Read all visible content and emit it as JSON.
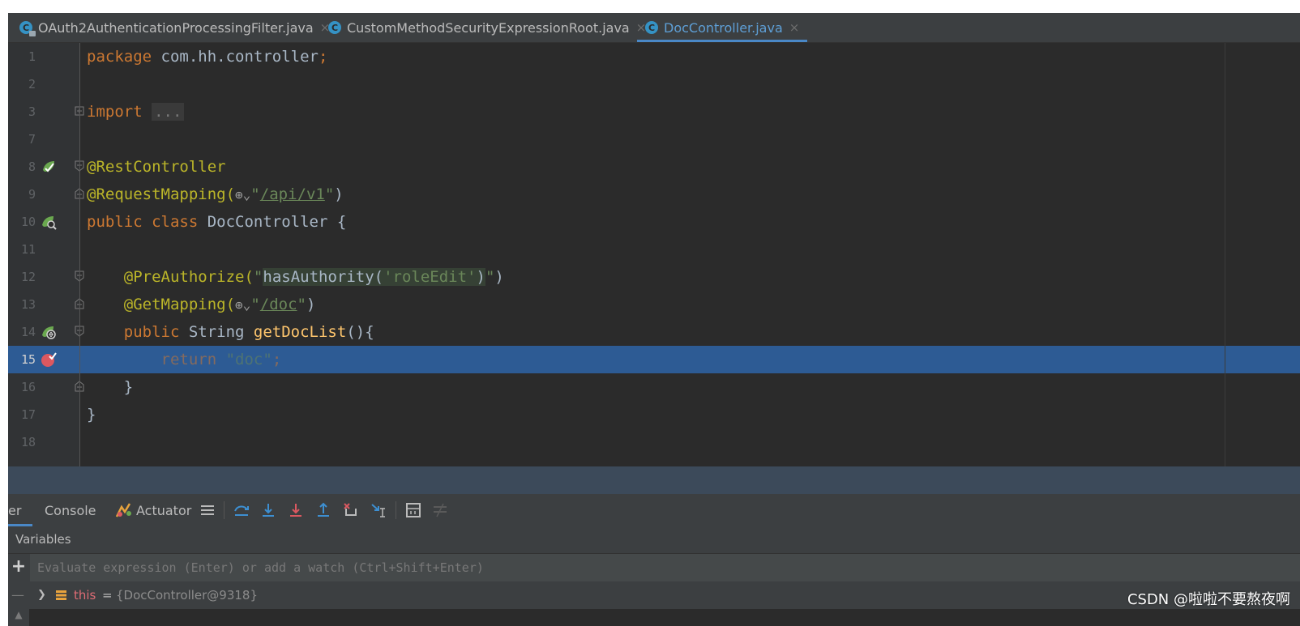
{
  "tabs": [
    {
      "label": "OAuth2AuthenticationProcessingFilter.java",
      "icon": "java-class-icon",
      "locked": true,
      "active": false
    },
    {
      "label": "CustomMethodSecurityExpressionRoot.java",
      "icon": "java-class-icon",
      "locked": false,
      "active": false
    },
    {
      "label": "DocController.java",
      "icon": "java-class-icon",
      "locked": false,
      "active": true
    }
  ],
  "close_glyph": "×",
  "editor": {
    "line_numbers": [
      "1",
      "2",
      "3",
      "7",
      "8",
      "9",
      "10",
      "11",
      "12",
      "13",
      "14",
      "15",
      "16",
      "17",
      "18"
    ],
    "code": {
      "l1_kw": "package",
      "l1_rest": " com.hh.controller",
      "semi": ";",
      "l3_kw": "import",
      "l3_fold": "...",
      "l8_ann": "@RestController",
      "l9_ann": "@RequestMapping(",
      "l9_globe": "⊕⌄",
      "quote": "\"",
      "l9_url": "/api/v1",
      "close_paren": ")",
      "l10_kw": "public class",
      "l10_rest": " DocController {",
      "l12_ann": "@PreAuthorize(",
      "l12_expr": "hasAuthority(",
      "l12_arg": "'roleEdit'",
      "l13_ann": "@GetMapping(",
      "l13_url": "/doc",
      "l14_kw": "public",
      "l14_type": " String ",
      "l14_fn": "getDocList",
      "l14_rest": "(){",
      "l15_kw": "return",
      "l15_str": "\"doc\"",
      "l16_brace": "}",
      "l17_brace": "}"
    },
    "current_line": "15",
    "colors": {
      "keyword": "#cc7832",
      "annotation": "#bbb529",
      "string": "#6a8759",
      "function": "#ffc66d",
      "selection": "#2d5b94",
      "background": "#2b2b2b"
    }
  },
  "debug": {
    "tabs": {
      "partial": "er",
      "console": "Console",
      "actuator": "Actuator"
    },
    "toolbar_icons": [
      "list-icon",
      "show-execution-point-icon",
      "step-over-icon",
      "step-into-icon",
      "force-step-into-icon",
      "step-out-icon",
      "drop-frame-icon",
      "run-to-cursor-icon",
      "evaluate-expression-icon",
      "trace-icon"
    ],
    "variables_title": "Variables",
    "eval_plus": "+",
    "eval_placeholder": "Evaluate expression (Enter) or add a watch (Ctrl+Shift+Enter)",
    "variable": {
      "name": "this",
      "eq": "=",
      "value": "{DocController@9318}"
    }
  },
  "watermark": "CSDN @啦啦不要熬夜啊"
}
